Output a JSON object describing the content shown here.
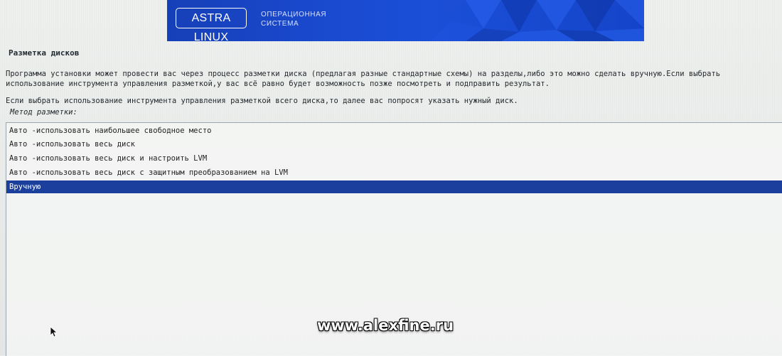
{
  "banner": {
    "logo_text": "ASTRA LINUX",
    "logo_sub_line1": "ОПЕРАЦИОННАЯ",
    "logo_sub_line2": "СИСТЕМА"
  },
  "page": {
    "title": "Разметка дисков",
    "paragraph1": "Программа установки может провести вас через процесс разметки диска (предлагая разные стандартные схемы) на разделы,либо это можно сделать вручную.Если выбрать использование инструмента управления разметкой,у вас всё равно будет возможность позже посмотреть и подправить результат.",
    "paragraph2": "Если выбрать использование инструмента управления разметкой всего диска,то далее вас попросят указать нужный диск.",
    "method_label": "Метод разметки:"
  },
  "methods": {
    "items": [
      {
        "label": "Авто -использовать наибольшее свободное место"
      },
      {
        "label": "Авто -использовать весь диск"
      },
      {
        "label": "Авто -использовать весь диск и настроить LVM"
      },
      {
        "label": "Авто -использовать весь диск с защитным преобразованием на LVM"
      },
      {
        "label": "Вручную"
      }
    ],
    "selected_index": 4
  },
  "watermark": "www.alexfine.ru",
  "colors": {
    "banner_blue": "#1b4fd8",
    "selection_blue": "#1b3f9c",
    "background": "#e9ecea"
  }
}
